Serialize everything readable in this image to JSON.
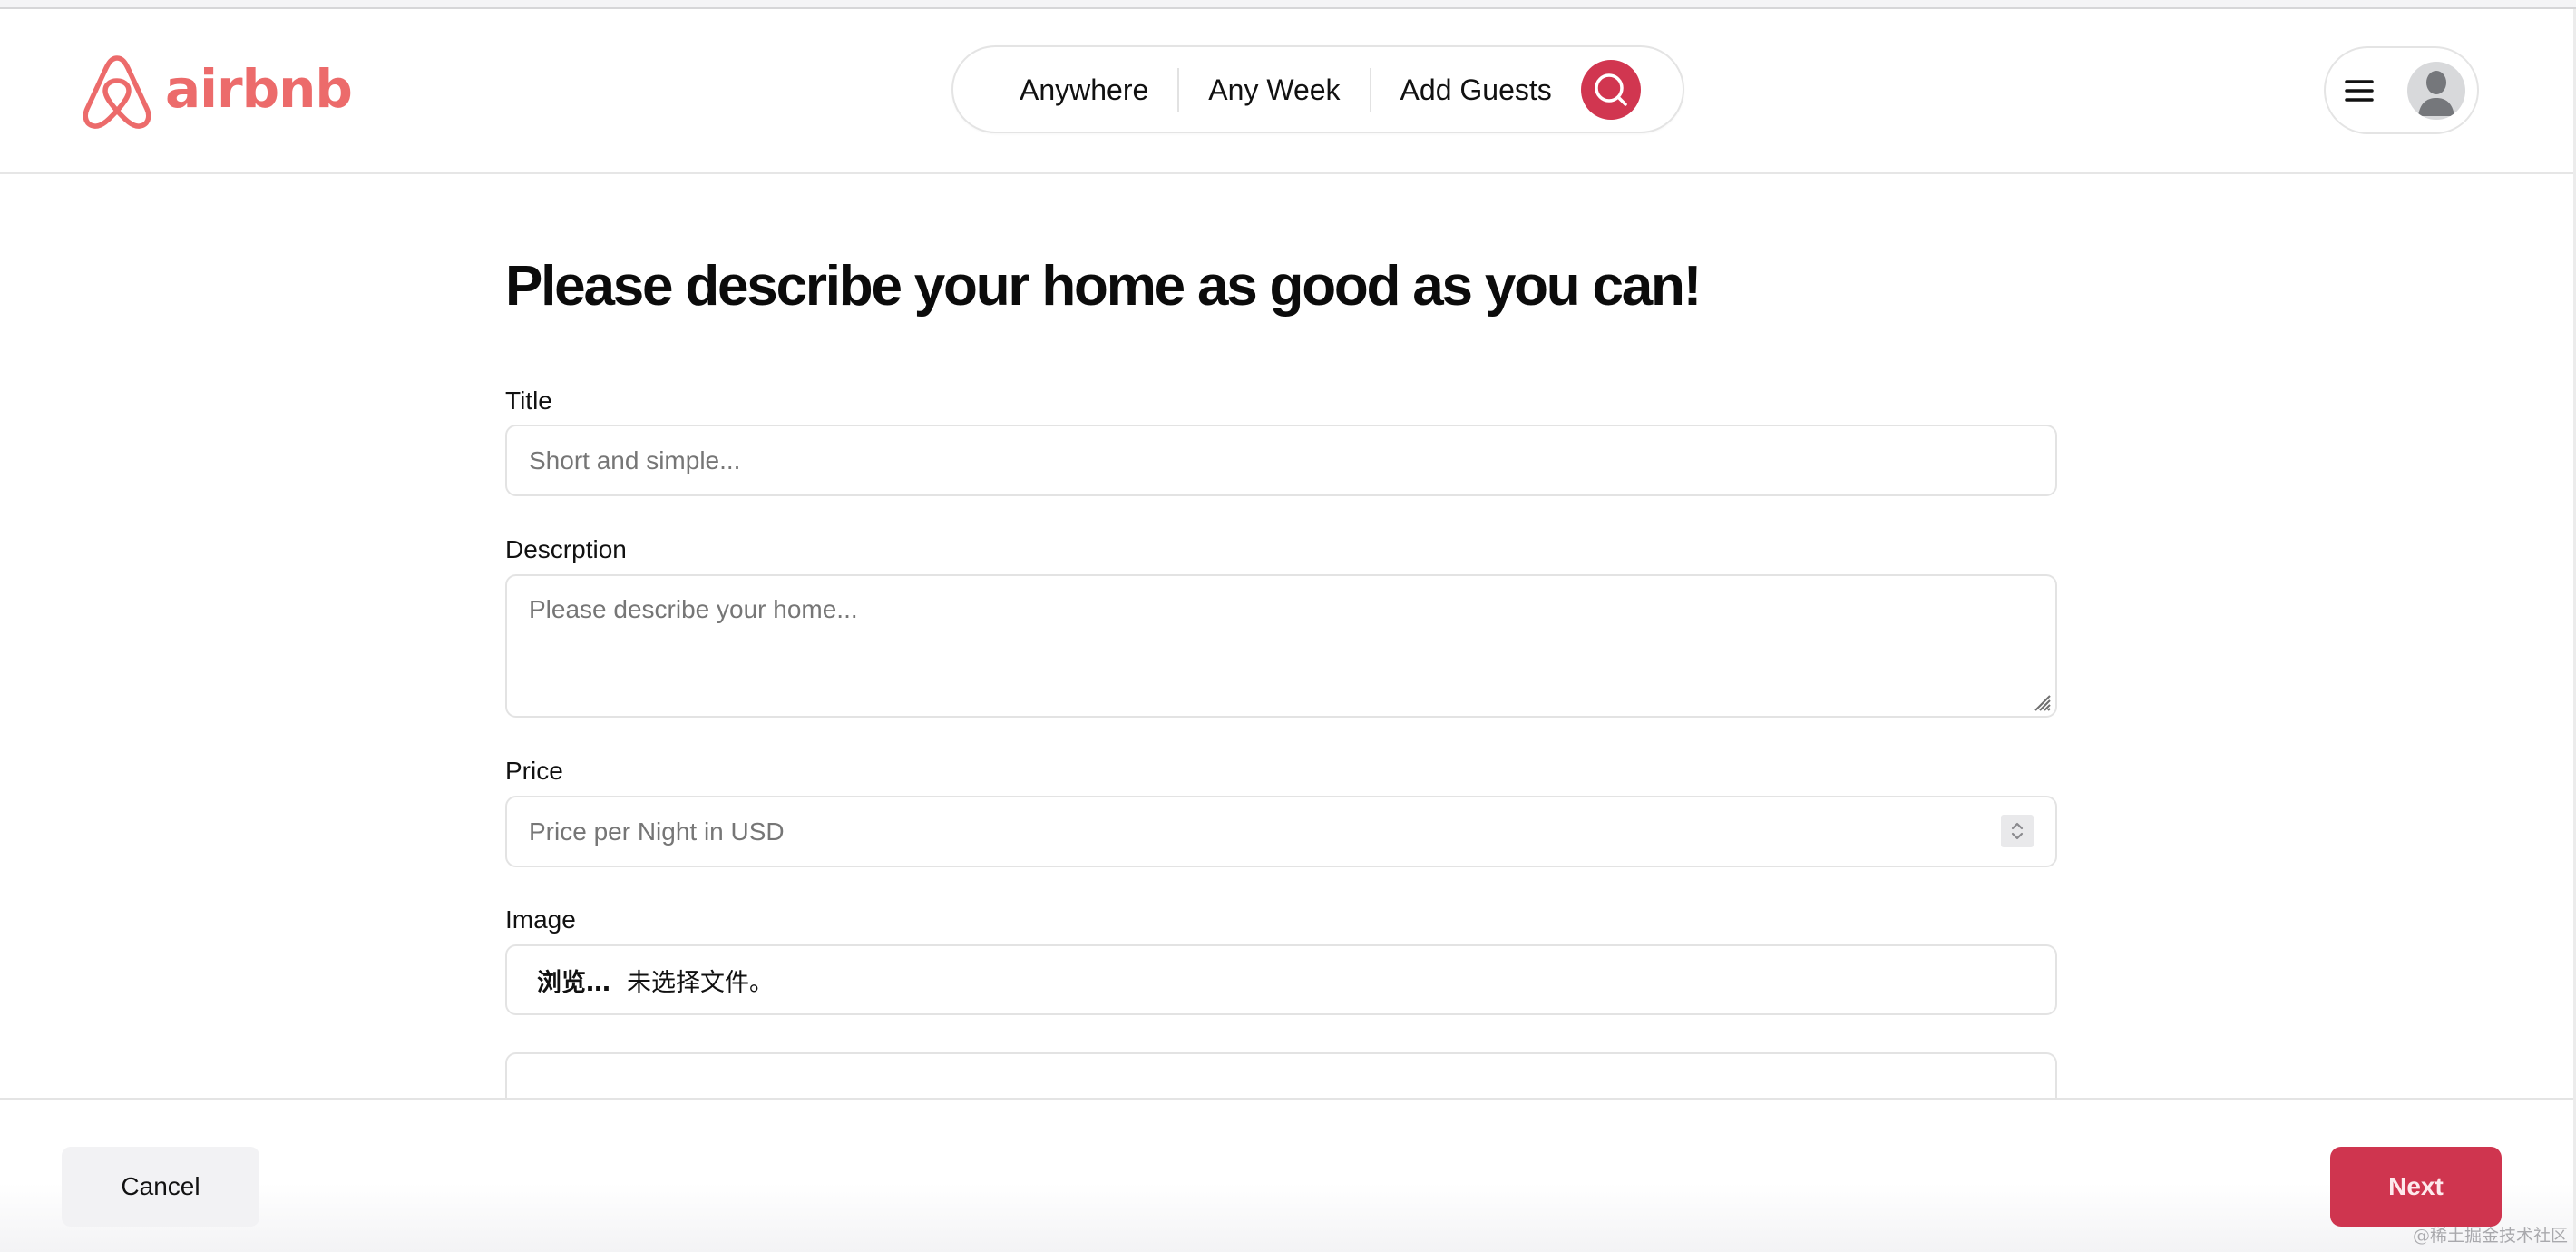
{
  "brand": {
    "name": "airbnb",
    "color": "#ec6b6b",
    "icon": "airbnb-logo-icon"
  },
  "header": {
    "search": {
      "items": [
        {
          "label": "Anywhere"
        },
        {
          "label": "Any Week"
        },
        {
          "label": "Add Guests"
        }
      ],
      "button_icon": "search-icon",
      "button_color": "#d13650"
    },
    "user_menu": {
      "menu_icon": "hamburger-menu-icon",
      "avatar_icon": "user-avatar-icon"
    }
  },
  "main": {
    "title": "Please describe your home as good as you can!",
    "fields": {
      "title": {
        "label": "Title",
        "value": "",
        "placeholder": "Short and simple..."
      },
      "description": {
        "label": "Descrption",
        "value": "",
        "placeholder": "Please describe your home..."
      },
      "price": {
        "label": "Price",
        "value": "",
        "placeholder": "Price per Night in USD"
      },
      "image": {
        "label": "Image",
        "button_label": "浏览…",
        "status": "未选择文件。"
      }
    }
  },
  "footer": {
    "cancel_label": "Cancel",
    "next_label": "Next",
    "accent_color": "#cf354f"
  },
  "watermark": "@稀土掘金技术社区"
}
